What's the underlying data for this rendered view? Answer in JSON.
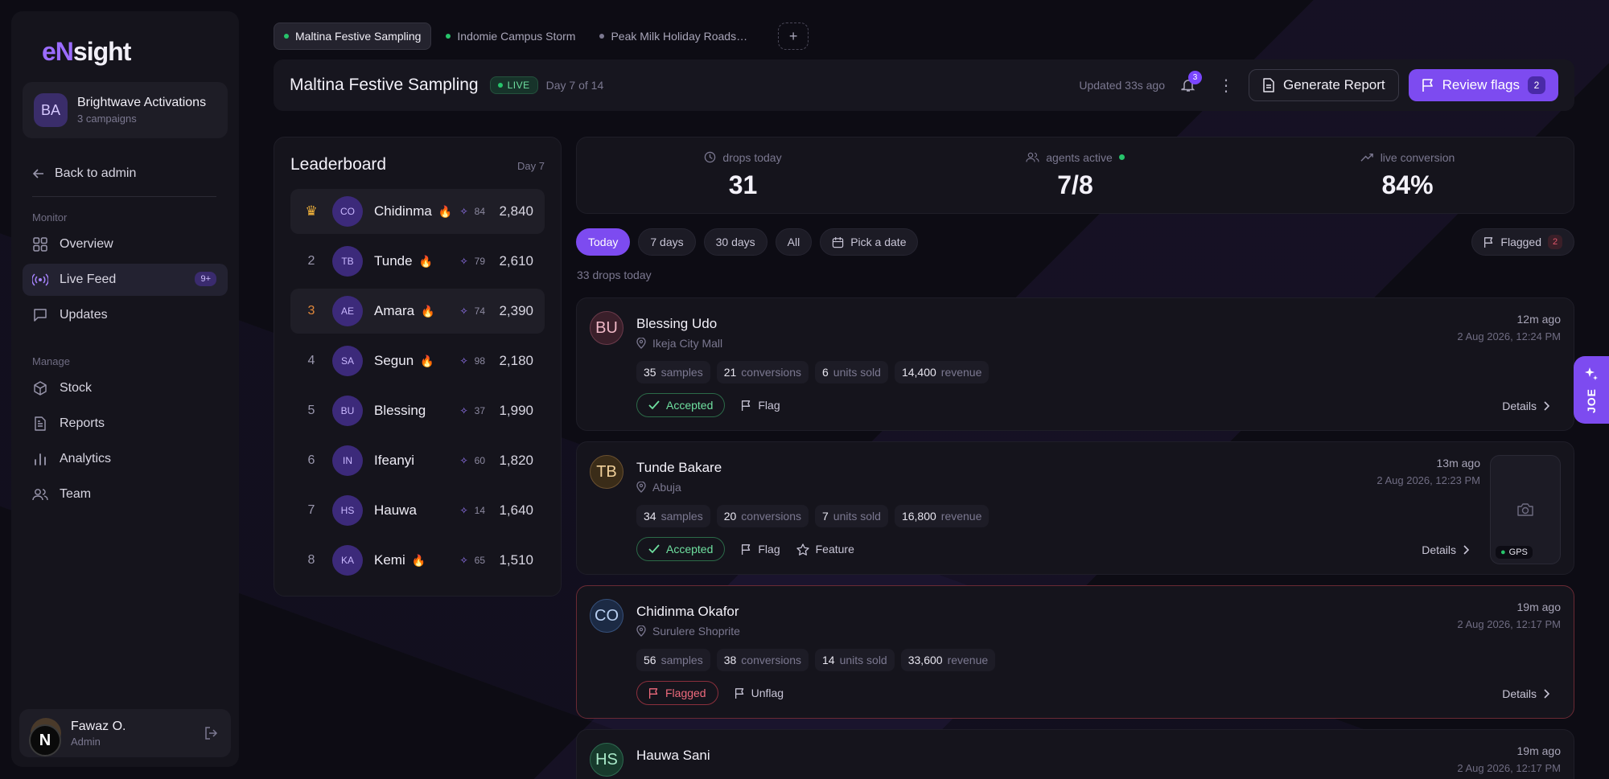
{
  "brand": {
    "logo_en": "eN",
    "logo_sight": "sight"
  },
  "workspace": {
    "initials": "BA",
    "name": "Brightwave Activations",
    "sub": "3 campaigns"
  },
  "sidebar": {
    "back": "Back to admin",
    "monitor_label": "Monitor",
    "manage_label": "Manage",
    "items": [
      {
        "label": "Overview"
      },
      {
        "label": "Live Feed",
        "badge": "9+"
      },
      {
        "label": "Updates"
      },
      {
        "label": "Stock"
      },
      {
        "label": "Reports"
      },
      {
        "label": "Analytics"
      },
      {
        "label": "Team"
      }
    ],
    "user": {
      "name": "Fawaz O.",
      "role": "Admin",
      "n_badge": "N"
    }
  },
  "tabs": [
    {
      "label": "Maltina Festive Sampling"
    },
    {
      "label": "Indomie Campus Storm"
    },
    {
      "label": "Peak Milk Holiday Roads…"
    }
  ],
  "header": {
    "title": "Maltina Festive Sampling",
    "live": "LIVE",
    "day": "Day 7 of 14",
    "updated": "Updated 33s ago",
    "bell_count": "3",
    "generate": "Generate Report",
    "review": "Review flags",
    "review_count": "2"
  },
  "leaderboard": {
    "title": "Leaderboard",
    "day": "Day 7",
    "rows": [
      {
        "rank": "",
        "initials": "CO",
        "name": "Chidinma",
        "streak": "84",
        "score": "2,840"
      },
      {
        "rank": "2",
        "initials": "TB",
        "name": "Tunde",
        "streak": "79",
        "score": "2,610"
      },
      {
        "rank": "3",
        "initials": "AE",
        "name": "Amara",
        "streak": "74",
        "score": "2,390"
      },
      {
        "rank": "4",
        "initials": "SA",
        "name": "Segun",
        "streak": "98",
        "score": "2,180"
      },
      {
        "rank": "5",
        "initials": "BU",
        "name": "Blessing",
        "streak": "37",
        "score": "1,990"
      },
      {
        "rank": "6",
        "initials": "IN",
        "name": "Ifeanyi",
        "streak": "60",
        "score": "1,820"
      },
      {
        "rank": "7",
        "initials": "HS",
        "name": "Hauwa",
        "streak": "14",
        "score": "1,640"
      },
      {
        "rank": "8",
        "initials": "KA",
        "name": "Kemi",
        "streak": "65",
        "score": "1,510"
      }
    ]
  },
  "stats": [
    {
      "label": "drops today",
      "value": "31"
    },
    {
      "label": "agents active",
      "value": "7/8"
    },
    {
      "label": "live conversion",
      "value": "84%"
    }
  ],
  "filters": {
    "today": "Today",
    "d7": "7 days",
    "d30": "30 days",
    "all": "All",
    "pick": "Pick a date",
    "flagged": "Flagged",
    "flagged_count": "2",
    "drop_count": "33 drops today"
  },
  "feed": [
    {
      "initials": "BU",
      "name": "Blessing Udo",
      "location": "Ikeja City Mall",
      "ago": "12m ago",
      "date": "2 Aug 2026, 12:24 PM",
      "samples": "35",
      "conversions": "21",
      "units": "6",
      "revenue": "14,400",
      "status": "Accepted",
      "act1": "Flag",
      "details": "Details"
    },
    {
      "initials": "TB",
      "name": "Tunde Bakare",
      "location": "Abuja",
      "ago": "13m ago",
      "date": "2 Aug 2026, 12:23 PM",
      "samples": "34",
      "conversions": "20",
      "units": "7",
      "revenue": "16,800",
      "status": "Accepted",
      "act1": "Flag",
      "act2": "Feature",
      "details": "Details",
      "gps": "GPS"
    },
    {
      "initials": "CO",
      "name": "Chidinma Okafor",
      "location": "Surulere Shoprite",
      "ago": "19m ago",
      "date": "2 Aug 2026, 12:17 PM",
      "samples": "56",
      "conversions": "38",
      "units": "14",
      "revenue": "33,600",
      "status": "Flagged",
      "act1": "Unflag",
      "details": "Details"
    },
    {
      "initials": "HS",
      "name": "Hauwa Sani",
      "ago": "19m ago",
      "date": "2 Aug 2026, 12:17 PM"
    }
  ],
  "metric_labels": {
    "samples": "samples",
    "conversions": "conversions",
    "units": "units sold",
    "revenue": "revenue"
  },
  "side_tab": {
    "label": "JOE"
  },
  "colors": {
    "accent": "#7d4bf0",
    "live": "#27c46b",
    "flag": "#ee6a7c"
  }
}
